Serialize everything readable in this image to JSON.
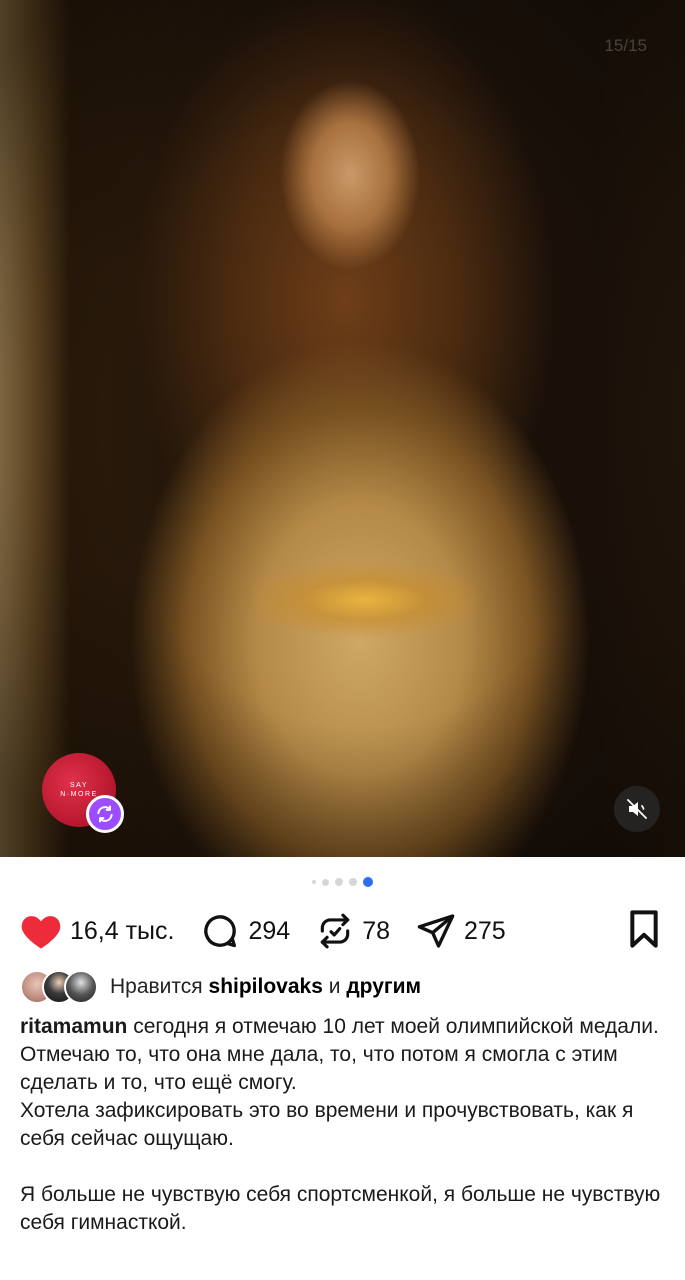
{
  "post": {
    "slide_counter": "15/15",
    "logo_text": [
      "SAY",
      "N·MORE"
    ],
    "carousel": {
      "dot_count": 5,
      "active_index": 4
    }
  },
  "actions": {
    "likes": "16,4 тыс.",
    "comments": "294",
    "reposts": "78",
    "shares": "275"
  },
  "liked_by": {
    "prefix": "Нравится",
    "user": "shipilovaks",
    "joiner": "и",
    "others": "другим"
  },
  "caption": {
    "username": "ritamamun",
    "paragraph1": "сегодня я отмечаю 10 лет моей олимпийской медали. Отмечаю то, что она мне дала, то, что потом я смогла с этим сделать и то, что ещё смогу.",
    "paragraph2": "Хотела зафиксировать это во времени и прочувствовать, как я себя сейчас ощущаю.",
    "paragraph3": "Я больше не чувствую себя спортсменкой, я больше не чувствую себя гимнасткой."
  },
  "colors": {
    "like_heart": "#ed2b3a",
    "active_dot": "#2f6df6",
    "repost_badge": "#9b4dff"
  }
}
